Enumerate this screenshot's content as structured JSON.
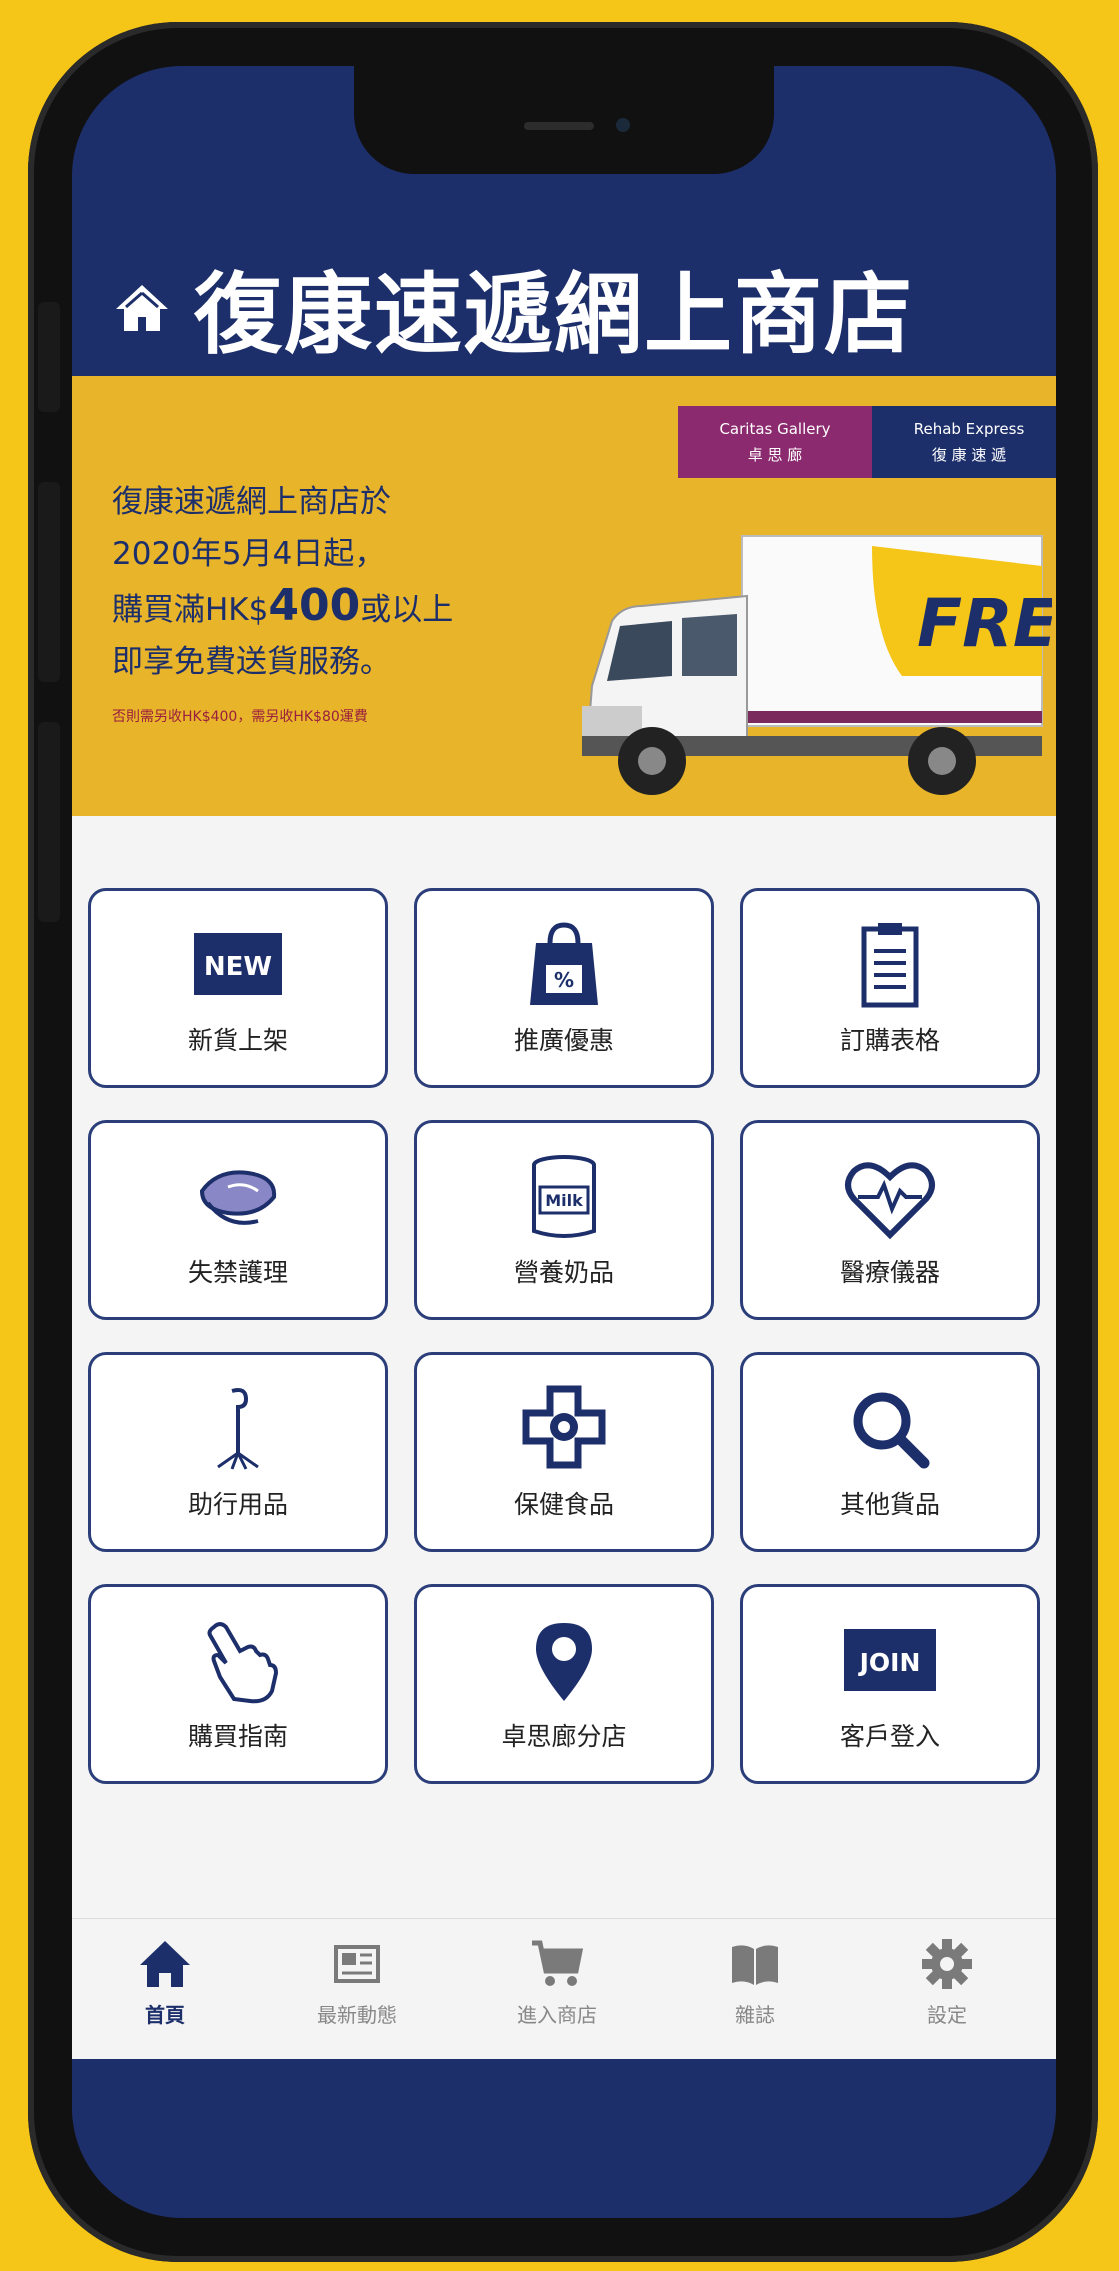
{
  "header": {
    "title": "復康速遞網上商店"
  },
  "banner": {
    "brand_a_en": "Caritas Gallery",
    "brand_a_zh": "卓 思 廊",
    "brand_b_en": "Rehab Express",
    "brand_b_zh": "復 康 速 遞",
    "line1": "復康速遞網上商店於",
    "line2": "2020年5月4日起，",
    "line3_pre": "購買滿HK$",
    "line3_amount": "400",
    "line3_post": "或以上",
    "line4": "即享免費送貨服務。",
    "small_note": "否則需另收HK$400，需另收HK$80運費",
    "truck_text": "FREE"
  },
  "grid": [
    {
      "label": "新貨上架",
      "icon": "new-icon",
      "icon_text": "NEW"
    },
    {
      "label": "推廣優惠",
      "icon": "discount-bag-icon",
      "icon_text": "%"
    },
    {
      "label": "訂購表格",
      "icon": "clipboard-icon"
    },
    {
      "label": "失禁護理",
      "icon": "diaper-icon"
    },
    {
      "label": "營養奶品",
      "icon": "milk-can-icon",
      "icon_text": "Milk"
    },
    {
      "label": "醫療儀器",
      "icon": "heartbeat-icon"
    },
    {
      "label": "助行用品",
      "icon": "walking-cane-icon"
    },
    {
      "label": "保健食品",
      "icon": "health-cross-icon"
    },
    {
      "label": "其他貨品",
      "icon": "search-icon"
    },
    {
      "label": "購買指南",
      "icon": "pointing-hand-icon"
    },
    {
      "label": "卓思廊分店",
      "icon": "location-pin-icon"
    },
    {
      "label": "客戶登入",
      "icon": "join-icon",
      "icon_text": "JOIN"
    }
  ],
  "tabs": [
    {
      "label": "首頁",
      "icon": "home-icon",
      "active": true
    },
    {
      "label": "最新動態",
      "icon": "news-icon"
    },
    {
      "label": "進入商店",
      "icon": "cart-icon"
    },
    {
      "label": "雜誌",
      "icon": "book-icon"
    },
    {
      "label": "設定",
      "icon": "gear-icon"
    }
  ],
  "colors": {
    "navy": "#1d2f6b",
    "yellow": "#f5c518",
    "banner": "#e8b42a",
    "purple": "#8b2a6e"
  }
}
